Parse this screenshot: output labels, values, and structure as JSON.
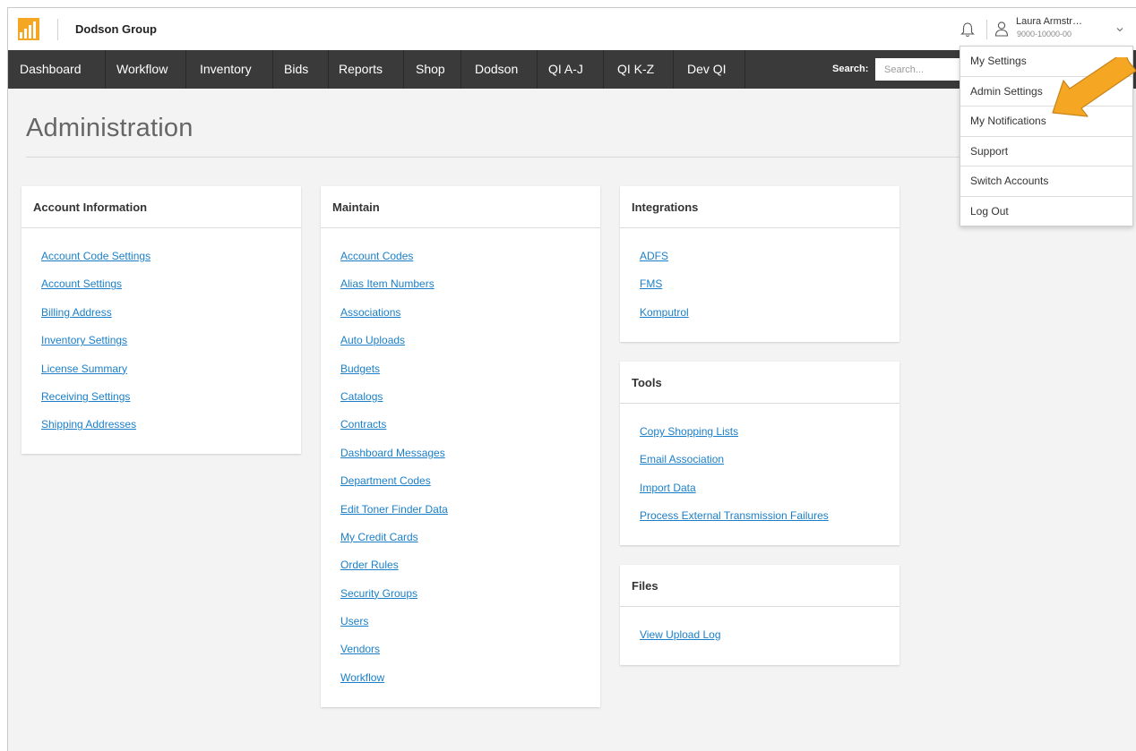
{
  "header": {
    "brand": "Dodson Group",
    "user_name": "Laura Armstr…",
    "user_account": "9000-10000-00"
  },
  "colors": {
    "accent": "#f5a623",
    "nav_bg": "#3a3a3a",
    "link": "#1a7fc8"
  },
  "icons": [
    "logo-icon",
    "bell-icon",
    "user-icon",
    "chevron-down-icon"
  ],
  "nav": {
    "items": [
      "Dashboard",
      "Workflow",
      "Inventory",
      "Bids",
      "Reports",
      "Shop",
      "Dodson",
      "QI A-J",
      "QI K-Z",
      "Dev QI"
    ],
    "search_label": "Search:",
    "search_placeholder": "Search..."
  },
  "page": {
    "title": "Administration"
  },
  "cards": {
    "account_information": {
      "title": "Account Information",
      "links": [
        "Account Code Settings",
        "Account Settings",
        "Billing Address",
        "Inventory Settings",
        "License Summary",
        "Receiving Settings",
        "Shipping Addresses"
      ]
    },
    "maintain": {
      "title": "Maintain",
      "links": [
        "Account Codes",
        "Alias Item Numbers",
        "Associations",
        "Auto Uploads",
        "Budgets",
        "Catalogs",
        "Contracts",
        "Dashboard Messages",
        "Department Codes",
        "Edit Toner Finder Data",
        "My Credit Cards",
        "Order Rules",
        "Security Groups",
        "Users",
        "Vendors",
        "Workflow"
      ]
    },
    "integrations": {
      "title": "Integrations",
      "links": [
        "ADFS",
        "FMS",
        "Komputrol"
      ]
    },
    "tools": {
      "title": "Tools",
      "links": [
        "Copy Shopping Lists",
        "Email Association",
        "Import Data",
        "Process External Transmission Failures"
      ]
    },
    "files": {
      "title": "Files",
      "links": [
        "View Upload Log"
      ]
    }
  },
  "user_menu": {
    "items": [
      "My Settings",
      "Admin Settings",
      "My Notifications",
      "Support",
      "Switch Accounts",
      "Log Out"
    ]
  }
}
